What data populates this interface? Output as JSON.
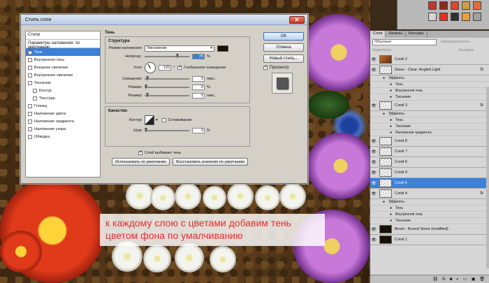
{
  "caption": {
    "line1": "к каждому слою с цветами добавим тень",
    "line2": "цветом фона по умалчиванию"
  },
  "dialog": {
    "title": "Стиль слоя",
    "close": "✕",
    "styles_header": "Стили",
    "blend_defaults": "Параметры наложения: по умолчанию",
    "styles": [
      {
        "label": "Тень",
        "checked": true,
        "active": true,
        "sub": false
      },
      {
        "label": "Внутренняя тень",
        "checked": false,
        "active": false,
        "sub": false
      },
      {
        "label": "Внешнее свечение",
        "checked": false,
        "active": false,
        "sub": false
      },
      {
        "label": "Внутреннее свечение",
        "checked": false,
        "active": false,
        "sub": false
      },
      {
        "label": "Тиснение",
        "checked": false,
        "active": false,
        "sub": false
      },
      {
        "label": "Контур",
        "checked": false,
        "active": false,
        "sub": true
      },
      {
        "label": "Текстура",
        "checked": false,
        "active": false,
        "sub": true
      },
      {
        "label": "Глянец",
        "checked": false,
        "active": false,
        "sub": false
      },
      {
        "label": "Наложение цвета",
        "checked": false,
        "active": false,
        "sub": false
      },
      {
        "label": "Наложение градиента",
        "checked": false,
        "active": false,
        "sub": false
      },
      {
        "label": "Наложение узора",
        "checked": false,
        "active": false,
        "sub": false
      },
      {
        "label": "Обводка",
        "checked": false,
        "active": false,
        "sub": false
      }
    ],
    "section_title": "Тень",
    "structure_title": "Структура",
    "blend_mode_label": "Режим наложения:",
    "blend_mode_value": "Умножение",
    "opacity_label": "Непрозр.:",
    "opacity_value": "75",
    "opacity_fraction": 0.75,
    "percent": "%",
    "angle_label": "Угол:",
    "angle_value": "120",
    "angle_unit": "°",
    "global_light": "Глобальное освещение",
    "offset_label": "Смещение:",
    "offset_value": "5",
    "spread_label": "Размах:",
    "spread_value": "0",
    "size_label": "Размер:",
    "size_value": "5",
    "px": "пикс.",
    "quality_title": "Качество",
    "contour_label": "Контур:",
    "antialias": "Сглаживание",
    "noise_label": "Шум:",
    "noise_value": "0",
    "knockout": "Слой выбивает тень",
    "make_default": "Использовать по умолчанию",
    "reset_default": "Восстановить значения по умолчанию",
    "ok": "OK",
    "cancel": "Отмена",
    "new_style": "Новый стиль...",
    "preview": "Просмотр",
    "shadow_color": "#1a1008"
  },
  "layers": {
    "tabs": [
      "Слои",
      "Каналы",
      "Контуры"
    ],
    "blend_mode": "Обычные",
    "opacity_label": "Непрозрачность:",
    "lock_label": "Закрепить:",
    "fill_label": "Заливка:",
    "items": [
      {
        "type": "layer",
        "name": "Слой 2",
        "thumb": "art",
        "fx": false,
        "sel": false
      },
      {
        "type": "layer",
        "name": "Glass - Clear: Angled Light",
        "thumb": "check",
        "fx": true,
        "sel": false
      },
      {
        "type": "effects",
        "name": "Эффекты"
      },
      {
        "type": "effect",
        "name": "Тень"
      },
      {
        "type": "effect",
        "name": "Внутренняя тень"
      },
      {
        "type": "effect",
        "name": "Тиснение"
      },
      {
        "type": "layer",
        "name": "Слой 3",
        "thumb": "check",
        "fx": true,
        "sel": false
      },
      {
        "type": "effects",
        "name": "Эффекты"
      },
      {
        "type": "effect",
        "name": "Тень"
      },
      {
        "type": "effect",
        "name": "Тиснение"
      },
      {
        "type": "effect",
        "name": "Наложение градиента"
      },
      {
        "type": "layer",
        "name": "Слой 8",
        "thumb": "check",
        "fx": false,
        "sel": false
      },
      {
        "type": "layer",
        "name": "Слой 7",
        "thumb": "check",
        "fx": false,
        "sel": false
      },
      {
        "type": "layer",
        "name": "Слой 6",
        "thumb": "check",
        "fx": false,
        "sel": false
      },
      {
        "type": "layer",
        "name": "Слой 9",
        "thumb": "check",
        "fx": false,
        "sel": false
      },
      {
        "type": "layer",
        "name": "Слой 5",
        "thumb": "check",
        "fx": false,
        "sel": true
      },
      {
        "type": "layer",
        "name": "Слой 4",
        "thumb": "check",
        "fx": true,
        "sel": false
      },
      {
        "type": "effects",
        "name": "Эффекты"
      },
      {
        "type": "effect",
        "name": "Тень"
      },
      {
        "type": "effect",
        "name": "Внутренняя тень"
      },
      {
        "type": "effect",
        "name": "Тиснение"
      },
      {
        "type": "layer",
        "name": "Bevel - Round Stone (modified)",
        "thumb": "dark",
        "fx": false,
        "sel": false
      },
      {
        "type": "layer",
        "name": "Слой 1",
        "thumb": "dark",
        "fx": false,
        "sel": false
      }
    ],
    "bottom_icons": [
      "link-icon",
      "fx-icon",
      "mask-icon",
      "adjustment-icon",
      "folder-icon",
      "new-layer-icon",
      "trash-icon"
    ],
    "bottom_glyphs": [
      "⛓",
      "fx",
      "◙",
      "◐",
      "▭",
      "▣",
      "🗑"
    ]
  },
  "colors": {
    "selection_blue": "#3b82d8",
    "caption_text": "#e23030"
  }
}
